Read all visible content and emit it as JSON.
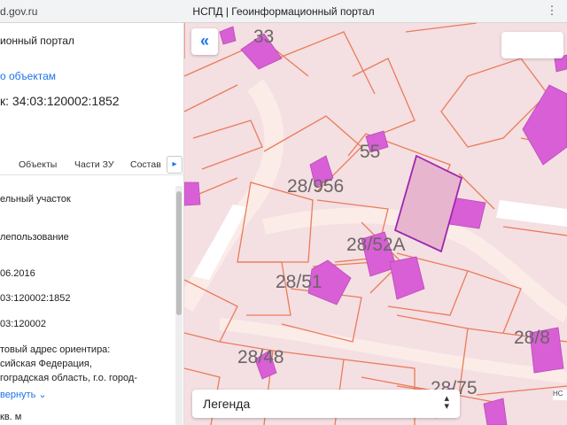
{
  "browser": {
    "url": "d.gov.ru",
    "title": "НСПД | Геоинформационный портал"
  },
  "panel": {
    "brand": "ионный портал",
    "back_link": "о объектам",
    "title": "к: 34:03:120002:1852",
    "tabs": [
      "Объекты",
      "Части ЗУ",
      "Состав"
    ],
    "attributes": [
      "ельный участок",
      "лепользование",
      "06.2016",
      "03:120002:1852",
      "03:120002",
      "товый адрес ориентира:",
      "сийская Федерация,",
      "гоградская область, г.о. город-"
    ],
    "collapse_label": "вернуть",
    "area_label": "кв. м"
  },
  "map": {
    "labels": [
      "33",
      "55",
      "28/956",
      "28/52А",
      "28/51",
      "28/48",
      "28/75",
      "28/8"
    ],
    "legend_label": "Легенда",
    "corner_text": "НС",
    "colors": {
      "background": "#f4dfe3",
      "parcel_border": "#ea7c57",
      "building_fill": "#d95fd6",
      "selected_border": "#9c27b0",
      "selected_fill": "#e8b5cf"
    }
  }
}
